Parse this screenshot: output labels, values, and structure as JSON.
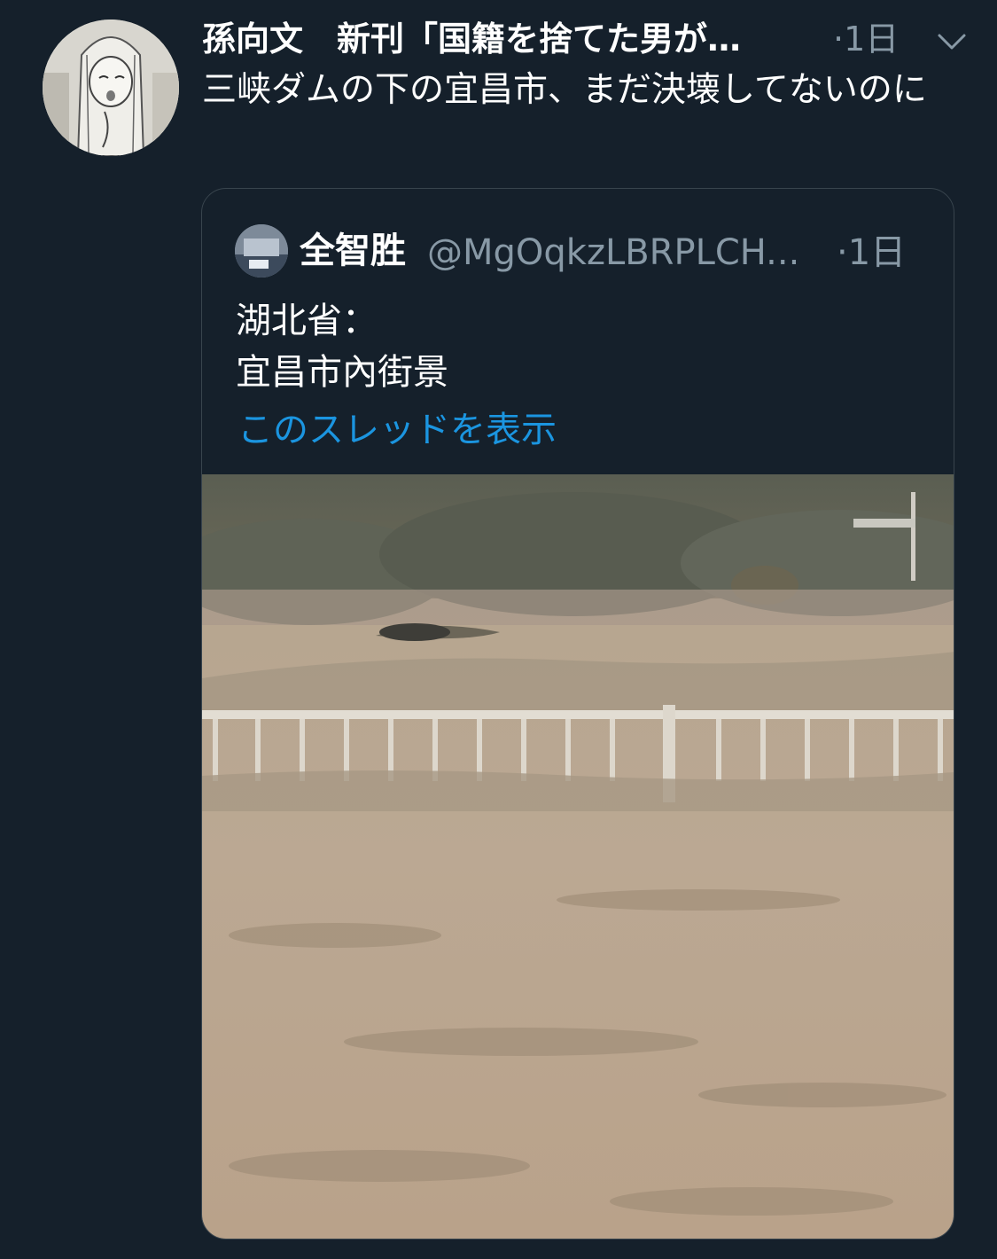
{
  "tweet": {
    "display_name": "孫向文　新刊「国籍を捨てた男が…",
    "timestamp": "·1日",
    "text": "三峡ダムの下の宜昌市、まだ決壊してないのに",
    "more_icon": "chevron-down-icon"
  },
  "quoted": {
    "display_name": "全智胜",
    "handle": "@MgOqkzLBRPLCH...",
    "timestamp": "·1日",
    "text_lines": [
      "湖北省：",
      "宜昌市內街景"
    ],
    "thread_link": "このスレッドを表示"
  },
  "colors": {
    "background": "#15202b",
    "secondary_text": "#8899a6",
    "link": "#1b95e0",
    "border": "#38444d"
  }
}
